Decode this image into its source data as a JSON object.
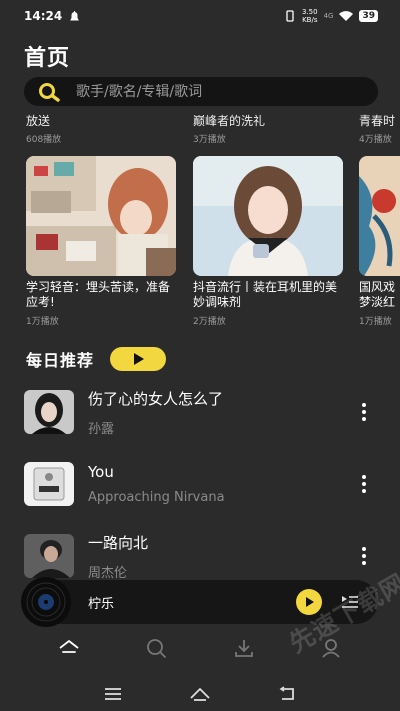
{
  "status_bar": {
    "time": "14:24",
    "speed_value": "3.50",
    "speed_unit": "KB/s",
    "network": "4G",
    "battery": "39"
  },
  "header": {
    "title": "首页"
  },
  "search": {
    "placeholder": "歌手/歌名/专辑/歌词"
  },
  "top_partial": [
    {
      "title": "放送",
      "count": "608播放"
    },
    {
      "title": "巅峰者的洗礼",
      "count": "3万播放"
    },
    {
      "title": "青春时",
      "count": "4万播放"
    }
  ],
  "playlists": [
    {
      "title": "学习轻音：埋头苦读，准备应考!",
      "count": "1万播放"
    },
    {
      "title": "抖音流行丨装在耳机里的美妙调味剂",
      "count": "2万播放"
    },
    {
      "title": "国风戏梦淡红",
      "count": "1万播放"
    }
  ],
  "daily": {
    "label": "每日推荐"
  },
  "songs": [
    {
      "name": "伤了心的女人怎么了",
      "artist": "孙露"
    },
    {
      "name": "You",
      "artist": "Approaching Nirvana"
    },
    {
      "name": "一路向北",
      "artist": "周杰伦"
    }
  ],
  "now_playing": {
    "title": "柠乐"
  },
  "watermark": "先速下载网",
  "colors": {
    "accent": "#f2d73f",
    "background": "#2b2b2b"
  },
  "icons": {
    "tabs": [
      "home-icon",
      "search-icon",
      "download-icon",
      "profile-icon"
    ],
    "system_nav": [
      "menu-icon",
      "home-icon",
      "back-icon"
    ]
  }
}
